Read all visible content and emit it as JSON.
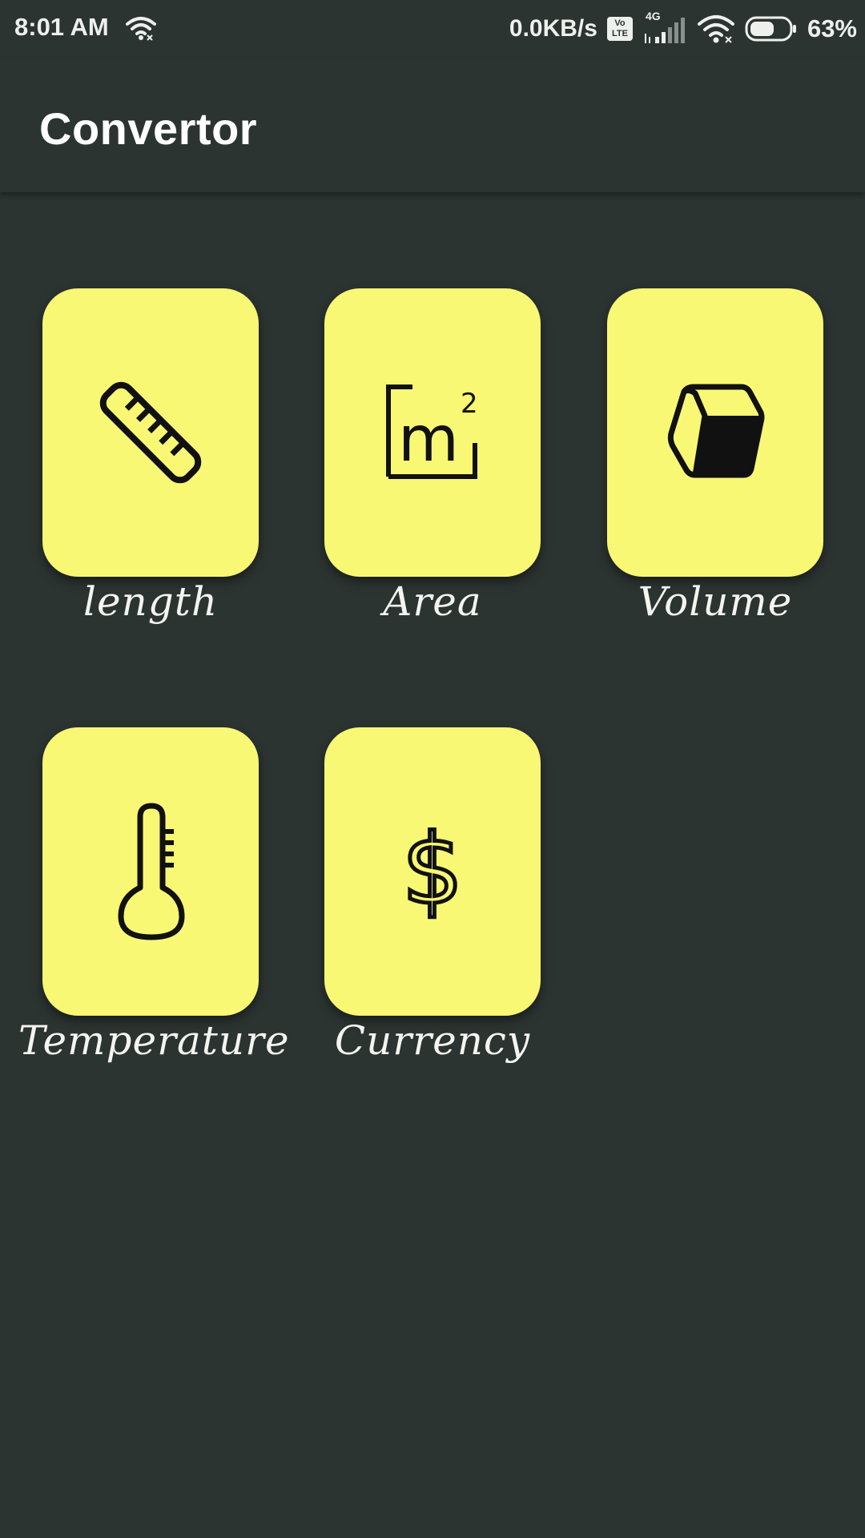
{
  "status_bar": {
    "time": "8:01 AM",
    "network_speed": "0.0KB/s",
    "volte_top": "Vo",
    "volte_bottom": "LTE",
    "network_type": "4G",
    "battery_percent": "63%",
    "battery_level": 0.63
  },
  "app_bar": {
    "title": "Convertor"
  },
  "categories": [
    {
      "label": "length",
      "icon": "ruler-icon"
    },
    {
      "label": "Area",
      "icon": "square-meter-icon"
    },
    {
      "label": "Volume",
      "icon": "cube-icon"
    },
    {
      "label": "Temperature",
      "icon": "thermometer-icon"
    },
    {
      "label": "Currency",
      "icon": "dollar-icon"
    }
  ],
  "colors": {
    "background": "#2c3432",
    "tile": "#f8f874",
    "text": "#ffffff"
  }
}
